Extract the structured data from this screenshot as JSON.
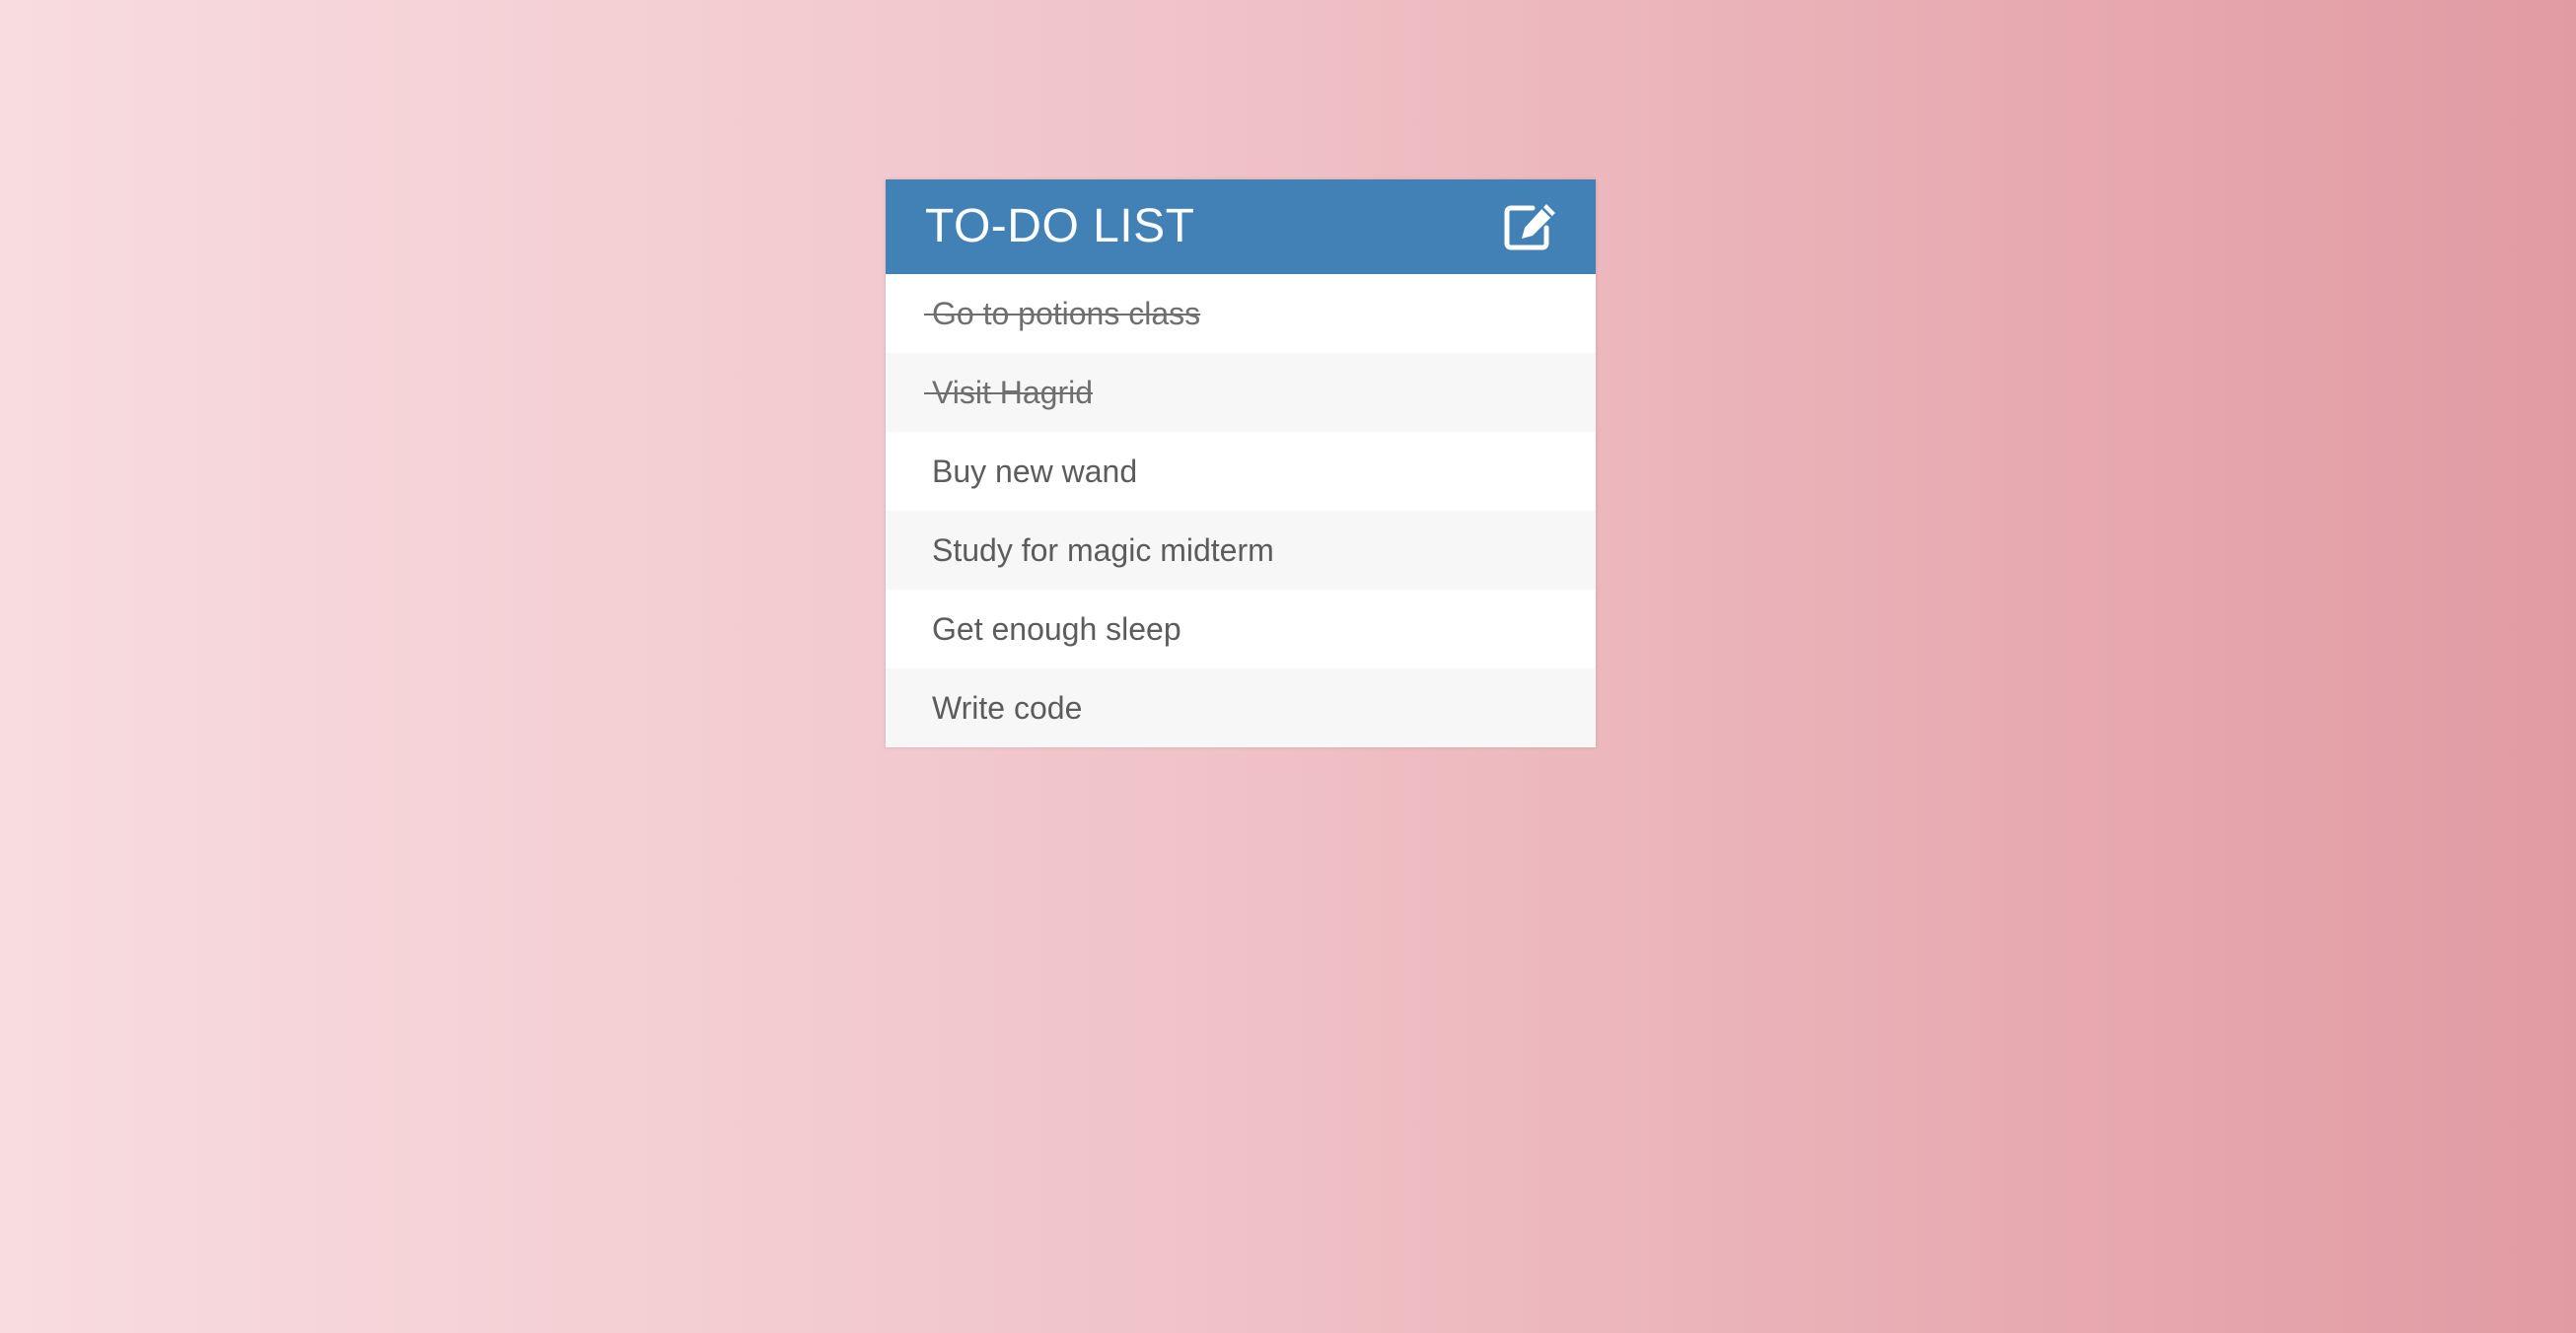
{
  "todo": {
    "title": "TO-DO LIST",
    "header_color": "#4281b6",
    "edit_icon": "pencil-square-icon",
    "items": [
      {
        "text": "Go to potions class",
        "completed": true
      },
      {
        "text": "Visit Hagrid",
        "completed": true
      },
      {
        "text": "Buy new wand",
        "completed": false
      },
      {
        "text": "Study for magic midterm",
        "completed": false
      },
      {
        "text": "Get enough sleep",
        "completed": false
      },
      {
        "text": "Write code",
        "completed": false
      }
    ]
  }
}
